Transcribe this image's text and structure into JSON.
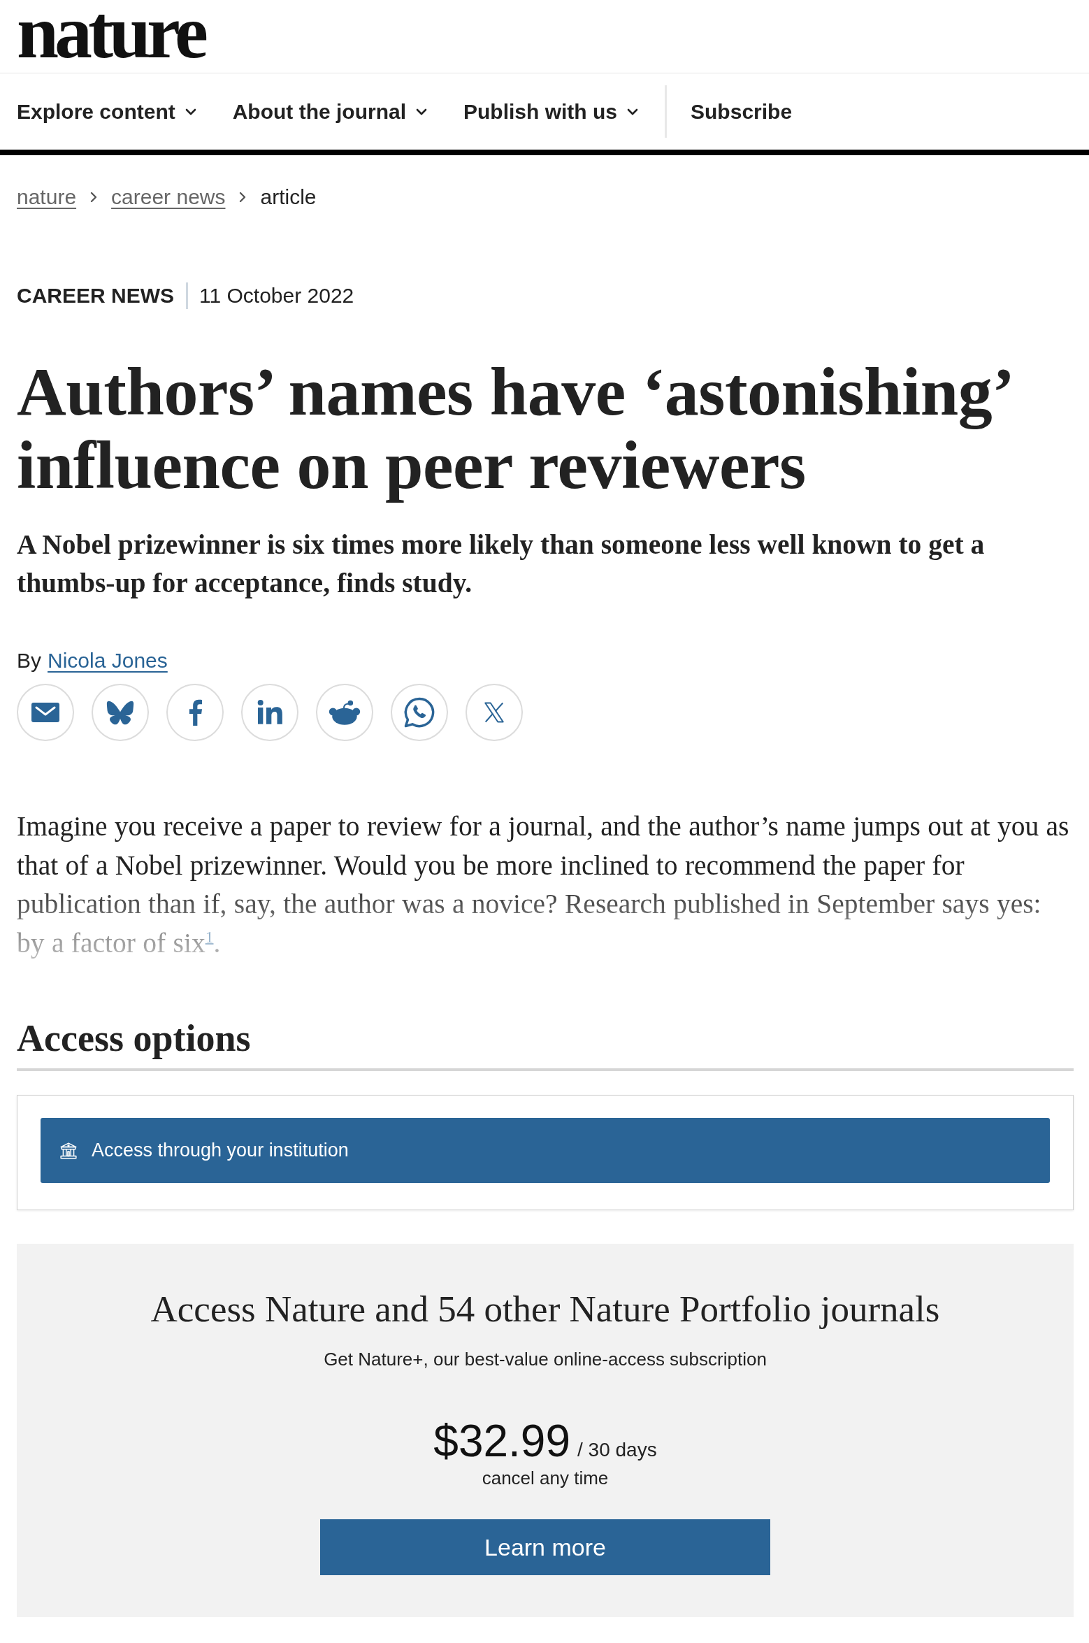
{
  "masthead": {
    "logo": "nature"
  },
  "nav": {
    "menus": [
      {
        "label": "Explore content"
      },
      {
        "label": "About the journal"
      },
      {
        "label": "Publish with us"
      }
    ],
    "subscribe": "Subscribe"
  },
  "breadcrumb": [
    {
      "label": "nature",
      "kind": "link"
    },
    {
      "label": "career news",
      "kind": "link"
    },
    {
      "label": "article",
      "kind": "current"
    }
  ],
  "article": {
    "type": "CAREER NEWS",
    "date": "11 October 2022",
    "title": "Authors’ names have ‘astonishing’ influence on peer reviewers",
    "standfirst": "A Nobel prizewinner is six times more likely than someone less well known to get a thumbs-up for acceptance, finds study.",
    "byline": {
      "prefix": "By",
      "author": "Nicola Jones"
    },
    "share_buttons": [
      {
        "kind": "email"
      },
      {
        "kind": "bluesky"
      },
      {
        "kind": "facebook"
      },
      {
        "kind": "linkedin"
      },
      {
        "kind": "reddit"
      },
      {
        "kind": "whatsapp"
      },
      {
        "kind": "x"
      }
    ],
    "body": "Imagine you receive a paper to review for a journal, and the author’s name jumps out at you as that of a Nobel prizewinner. Would you be more inclined to recommend the paper for publication than if, say, the author was a novice? Research published in September says yes: by a factor of six$^{1}$."
  },
  "access_options": {
    "heading": "Access options",
    "institution_button": "Access through your institution"
  },
  "subscription": {
    "title": "Access Nature and 54 other Nature Portfolio journals",
    "subtitle": "Get Nature+, our best-value online-access subscription",
    "price": "$32.99",
    "period": "/ 30 days",
    "note": "cancel any time",
    "button": "Learn more"
  }
}
